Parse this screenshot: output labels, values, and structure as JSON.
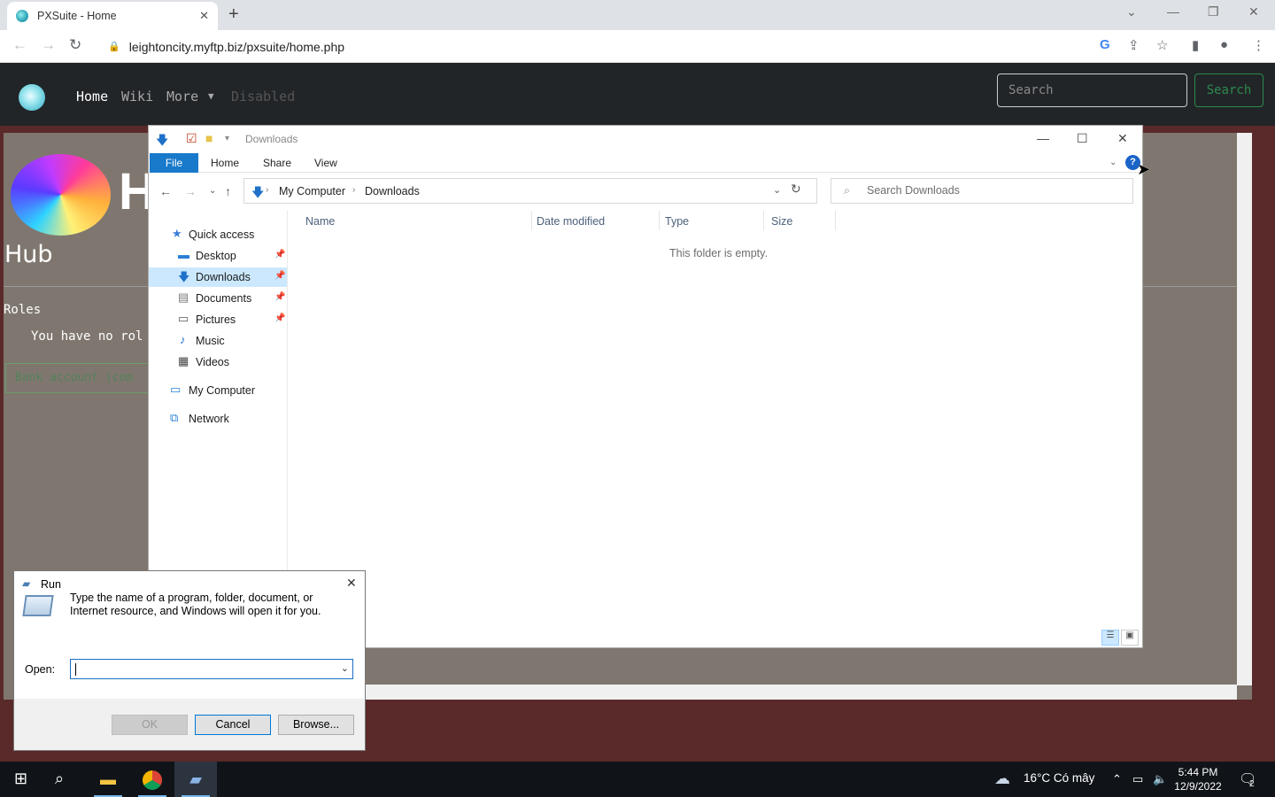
{
  "browser": {
    "tab_title": "PXSuite - Home",
    "tab_close": "✕",
    "new_tab": "+",
    "url": "leightoncity.myftp.biz/pxsuite/home.php"
  },
  "site": {
    "nav": {
      "home": "Home",
      "wiki": "Wiki",
      "more": "More",
      "disabled": "Disabled"
    },
    "search_placeholder": "Search",
    "search_button": "Search",
    "hub_big": "H",
    "hub_title": "Hub",
    "roles_heading": "Roles",
    "roles_note": "You have no rol",
    "bank_text": "Bank account (com"
  },
  "explorer": {
    "title": "Downloads",
    "ribbon": {
      "file": "File",
      "home": "Home",
      "share": "Share",
      "view": "View"
    },
    "help": "?",
    "breadcrumb": [
      "My Computer",
      "Downloads"
    ],
    "search_placeholder": "Search Downloads",
    "nav_items": [
      {
        "label": "Quick access",
        "icon": "star-icon"
      },
      {
        "label": "Desktop",
        "icon": "desktop-icon",
        "pinned": true
      },
      {
        "label": "Downloads",
        "icon": "download-icon",
        "pinned": true,
        "selected": true
      },
      {
        "label": "Documents",
        "icon": "document-icon",
        "pinned": true
      },
      {
        "label": "Pictures",
        "icon": "pictures-icon",
        "pinned": true
      },
      {
        "label": "Music",
        "icon": "music-icon"
      },
      {
        "label": "Videos",
        "icon": "videos-icon"
      },
      {
        "label": "My Computer",
        "icon": "computer-icon"
      },
      {
        "label": "Network",
        "icon": "network-icon"
      }
    ],
    "columns": [
      "Name",
      "Date modified",
      "Type",
      "Size"
    ],
    "empty_message": "This folder is empty."
  },
  "run": {
    "title": "Run",
    "description": "Type the name of a program, folder, document, or Internet resource, and Windows will open it for you.",
    "open_label": "Open:",
    "open_value": "",
    "ok": "OK",
    "cancel": "Cancel",
    "browse": "Browse..."
  },
  "taskbar": {
    "weather": "16°C  Có mây",
    "time": "5:44 PM",
    "date": "12/9/2022",
    "notifications": "2"
  }
}
